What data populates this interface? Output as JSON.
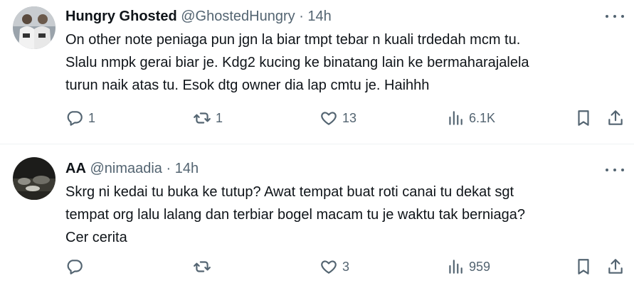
{
  "tweets": [
    {
      "author_name": "Hungry Ghosted",
      "handle": "@GhostedHungry",
      "separator": "·",
      "time": "14h",
      "text_lines": [
        "On other note peniaga pun jgn la biar tmpt tebar n kuali trdedah mcm tu.",
        "Slalu nmpk gerai biar je. Kdg2 kucing ke binatang lain ke bermaharajalela",
        "turun naik atas tu. Esok dtg owner dia lap cmtu je. Haihhh"
      ],
      "replies": "1",
      "retweets": "1",
      "likes": "13",
      "views": "6.1K"
    },
    {
      "author_name": "AA",
      "handle": "@nimaadia",
      "separator": "·",
      "time": "14h",
      "text_lines": [
        "Skrg ni kedai tu buka ke tutup? Awat tempat buat roti canai tu dekat sgt",
        "tempat org lalu lalang dan terbiar bogel macam tu je waktu tak berniaga?",
        "Cer cerita"
      ],
      "replies": "",
      "retweets": "",
      "likes": "3",
      "views": "959"
    }
  ],
  "icons": {
    "reply": "reply-icon",
    "retweet": "retweet-icon",
    "like": "heart-icon",
    "views": "views-icon",
    "bookmark": "bookmark-icon",
    "share": "share-icon",
    "more": "more-icon"
  },
  "colors": {
    "text": "#0f1419",
    "secondary": "#536471",
    "divider": "#eff3f4"
  }
}
